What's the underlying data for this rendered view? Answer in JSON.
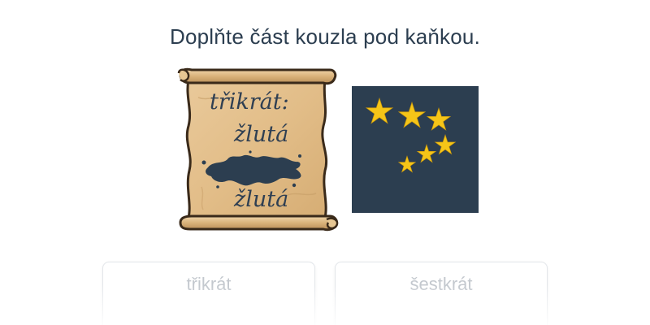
{
  "question": {
    "prompt": "Doplňte část kouzla pod kaňkou."
  },
  "scroll": {
    "lines": [
      "třikrát:",
      "žlutá",
      "žlutá"
    ],
    "hidden_part": "ink-blot"
  },
  "stars_card": {
    "background": "#2c3e50",
    "star_color": "#f5c518",
    "groups": [
      {
        "count": 3
      },
      {
        "count": 3
      }
    ]
  },
  "options": [
    {
      "label": "třikrát"
    },
    {
      "label": "šestkrát"
    }
  ]
}
